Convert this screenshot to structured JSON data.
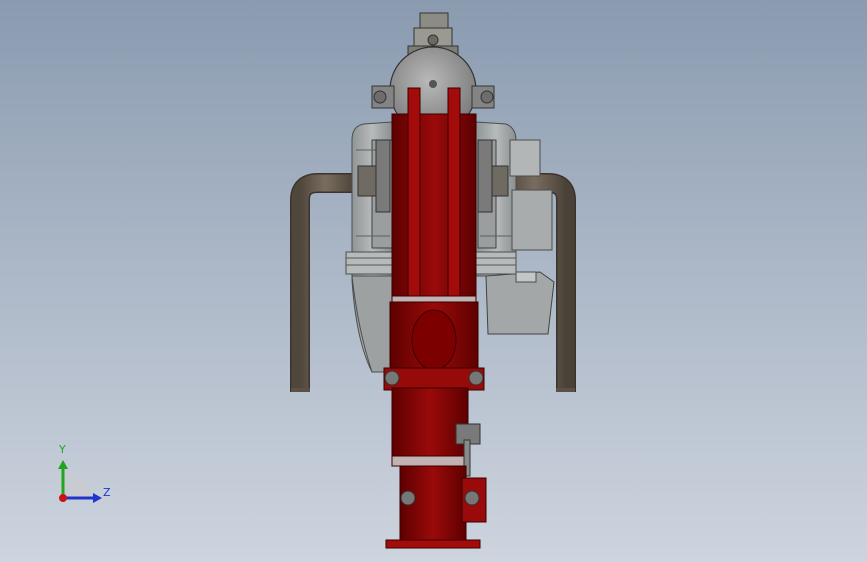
{
  "view": {
    "background_top": "#8a9bb0",
    "background_bottom": "#cdd4de"
  },
  "model": {
    "frame_color": "#8b0000",
    "pipe_color": "#6d6154",
    "housing_color": "#a9adad",
    "hub_color": "#9e9e9e"
  },
  "triad": {
    "y_label": "Y",
    "z_label": "Z",
    "y_color": "#1fa51f",
    "z_color": "#2233cc",
    "origin_color": "#cc1111"
  }
}
